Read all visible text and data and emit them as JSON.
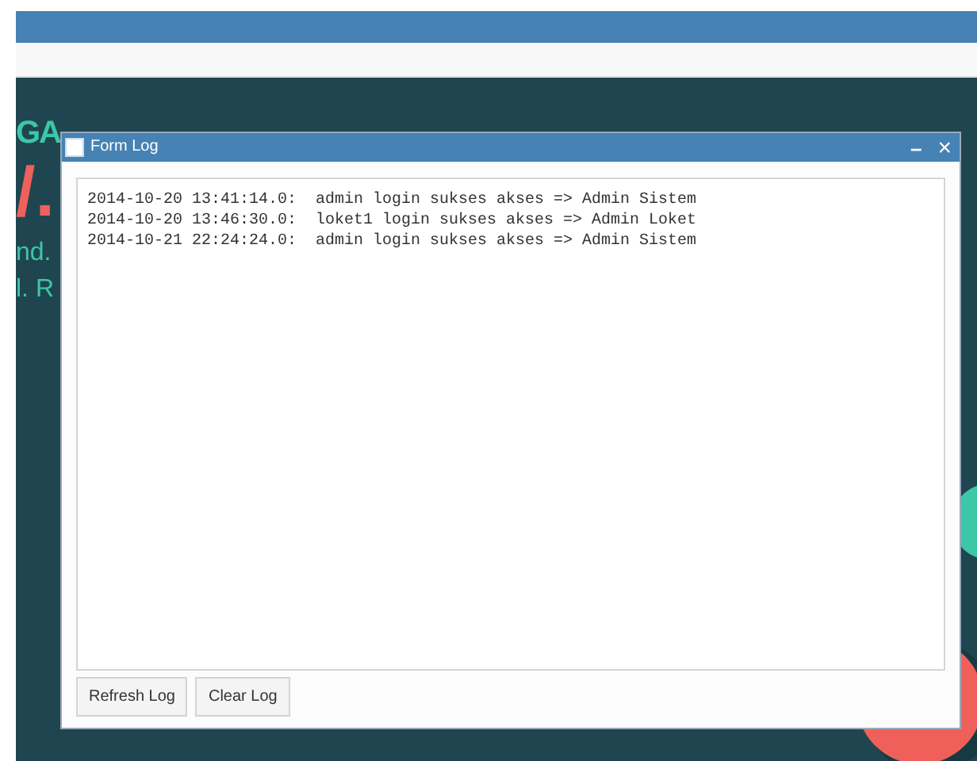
{
  "background": {
    "fragments": [
      "GA",
      "/.",
      "nd.",
      "l. R"
    ]
  },
  "window": {
    "title": "Form Log",
    "minimize": "–",
    "close": "×"
  },
  "log": [
    "2014-10-20 13:41:14.0:  admin login sukses akses => Admin Sistem",
    "2014-10-20 13:46:30.0:  loket1 login sukses akses => Admin Loket",
    "2014-10-21 22:24:24.0:  admin login sukses akses => Admin Sistem"
  ],
  "buttons": [
    "Refresh Log",
    "Clear Log"
  ]
}
